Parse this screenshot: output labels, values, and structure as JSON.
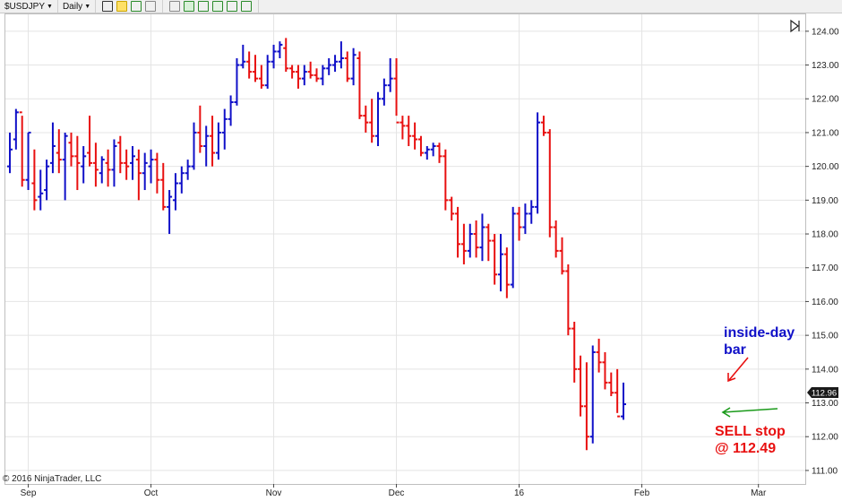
{
  "toolbar": {
    "symbol": "$USDJPY",
    "interval": "Daily",
    "tools": [
      "bar-style-icon",
      "pencil-icon",
      "drawing-tool-icon",
      "crosshair-icon",
      "zoom-icon",
      "data-box-icon",
      "grid-icon",
      "image-icon",
      "properties-icon",
      "export-icon"
    ]
  },
  "chart_data": {
    "type": "ohlc-bar",
    "x_ticks": [
      "Sep",
      "Oct",
      "Nov",
      "Dec",
      "16",
      "Feb",
      "Mar"
    ],
    "y_ticks": [
      111,
      112,
      113,
      114,
      115,
      116,
      117,
      118,
      119,
      120,
      121,
      122,
      123,
      124
    ],
    "y_tick_labels": [
      "111.00",
      "112.00",
      "113.00",
      "114.00",
      "115.00",
      "116.00",
      "117.00",
      "118.00",
      "119.00",
      "120.00",
      "121.00",
      "122.00",
      "123.00",
      "124.00"
    ],
    "ylim": [
      110.6,
      124.5
    ],
    "last_price": "112.96",
    "copyright": "© 2016 NinjaTrader, LLC",
    "colors": {
      "up": "#1010c8",
      "down": "#e81010"
    },
    "annotations": {
      "inside_day_line1": "inside-day",
      "inside_day_line2": "bar",
      "sell_line1": "SELL stop",
      "sell_line2": "@ 112.49"
    },
    "bars": [
      [
        120.0,
        121.0,
        119.8,
        120.5
      ],
      [
        120.8,
        121.7,
        120.5,
        121.6
      ],
      [
        121.6,
        121.5,
        119.4,
        119.6
      ],
      [
        119.6,
        121.0,
        119.3,
        121.0
      ],
      [
        119.5,
        120.5,
        118.7,
        119.0
      ],
      [
        119.1,
        119.9,
        118.7,
        119.2
      ],
      [
        119.3,
        120.2,
        119.0,
        120.0
      ],
      [
        120.1,
        121.3,
        119.8,
        120.6
      ],
      [
        120.4,
        121.1,
        119.8,
        120.2
      ],
      [
        120.2,
        121.0,
        119.0,
        120.9
      ],
      [
        120.7,
        121.0,
        120.0,
        120.3
      ],
      [
        120.3,
        120.9,
        119.3,
        120.1
      ],
      [
        120.0,
        120.6,
        119.5,
        120.3
      ],
      [
        120.4,
        121.5,
        120.0,
        120.1
      ],
      [
        120.1,
        120.7,
        119.4,
        119.9
      ],
      [
        119.8,
        120.3,
        119.5,
        120.2
      ],
      [
        120.1,
        120.5,
        119.4,
        119.9
      ],
      [
        119.9,
        120.8,
        119.4,
        120.6
      ],
      [
        120.7,
        120.9,
        119.8,
        120.1
      ],
      [
        120.1,
        120.5,
        119.6,
        120.0
      ],
      [
        120.1,
        120.6,
        119.6,
        120.3
      ],
      [
        120.2,
        120.5,
        119.0,
        119.8
      ],
      [
        119.8,
        120.4,
        119.3,
        120.1
      ],
      [
        120.0,
        120.5,
        119.5,
        120.2
      ],
      [
        120.2,
        120.4,
        119.2,
        119.6
      ],
      [
        119.6,
        120.1,
        118.7,
        118.8
      ],
      [
        118.8,
        119.3,
        118.0,
        119.1
      ],
      [
        119.0,
        119.8,
        118.7,
        119.5
      ],
      [
        119.5,
        120.0,
        119.2,
        119.8
      ],
      [
        119.8,
        120.2,
        119.6,
        120.0
      ],
      [
        120.0,
        121.3,
        119.9,
        121.0
      ],
      [
        121.0,
        121.8,
        120.4,
        120.6
      ],
      [
        120.6,
        121.2,
        120.0,
        120.9
      ],
      [
        120.9,
        121.5,
        120.0,
        120.4
      ],
      [
        120.4,
        121.3,
        120.2,
        121.0
      ],
      [
        121.0,
        121.7,
        120.5,
        121.4
      ],
      [
        121.4,
        122.1,
        121.2,
        121.9
      ],
      [
        121.9,
        123.2,
        121.8,
        123.0
      ],
      [
        123.0,
        123.6,
        122.9,
        123.1
      ],
      [
        123.1,
        123.4,
        122.6,
        122.8
      ],
      [
        122.8,
        123.3,
        122.5,
        122.6
      ],
      [
        122.6,
        123.0,
        122.3,
        122.4
      ],
      [
        122.4,
        123.3,
        122.3,
        123.1
      ],
      [
        123.1,
        123.6,
        122.9,
        123.4
      ],
      [
        123.4,
        123.7,
        123.2,
        123.6
      ],
      [
        123.5,
        123.8,
        122.8,
        122.9
      ],
      [
        122.9,
        123.0,
        122.6,
        122.8
      ],
      [
        122.8,
        123.0,
        122.3,
        122.6
      ],
      [
        122.6,
        123.0,
        122.4,
        122.8
      ],
      [
        122.8,
        123.1,
        122.6,
        122.7
      ],
      [
        122.7,
        122.9,
        122.5,
        122.6
      ],
      [
        122.6,
        123.0,
        122.4,
        122.9
      ],
      [
        122.9,
        123.2,
        122.7,
        123.0
      ],
      [
        123.0,
        123.3,
        122.8,
        123.1
      ],
      [
        123.1,
        123.7,
        122.9,
        123.2
      ],
      [
        123.2,
        123.4,
        122.5,
        122.6
      ],
      [
        122.6,
        123.5,
        122.4,
        123.3
      ],
      [
        123.2,
        123.4,
        121.4,
        121.5
      ],
      [
        121.5,
        121.8,
        121.0,
        121.3
      ],
      [
        121.3,
        122.0,
        120.7,
        120.9
      ],
      [
        120.9,
        122.2,
        120.6,
        122.0
      ],
      [
        122.0,
        122.6,
        121.8,
        122.4
      ],
      [
        122.4,
        123.2,
        122.2,
        122.6
      ],
      [
        122.6,
        123.2,
        121.5,
        121.3
      ],
      [
        121.3,
        121.5,
        120.8,
        121.2
      ],
      [
        121.2,
        121.5,
        120.6,
        120.9
      ],
      [
        120.9,
        121.3,
        120.5,
        120.8
      ],
      [
        120.8,
        120.9,
        120.3,
        120.4
      ],
      [
        120.4,
        120.6,
        120.2,
        120.5
      ],
      [
        120.5,
        120.7,
        120.3,
        120.6
      ],
      [
        120.6,
        120.7,
        120.1,
        120.3
      ],
      [
        120.3,
        120.5,
        118.7,
        119.0
      ],
      [
        119.0,
        119.1,
        118.4,
        118.6
      ],
      [
        118.6,
        118.8,
        117.3,
        117.7
      ],
      [
        117.7,
        118.3,
        117.1,
        117.5
      ],
      [
        117.5,
        118.3,
        117.3,
        118.0
      ],
      [
        118.0,
        118.4,
        117.3,
        117.6
      ],
      [
        117.6,
        118.6,
        117.2,
        118.2
      ],
      [
        118.2,
        118.3,
        117.2,
        117.8
      ],
      [
        117.8,
        118.0,
        116.5,
        116.8
      ],
      [
        116.8,
        118.0,
        116.3,
        117.4
      ],
      [
        117.4,
        117.6,
        116.1,
        116.5
      ],
      [
        116.5,
        118.8,
        116.4,
        118.6
      ],
      [
        118.6,
        118.8,
        117.8,
        118.2
      ],
      [
        118.2,
        118.9,
        118.0,
        118.6
      ],
      [
        118.6,
        119.0,
        118.3,
        118.8
      ],
      [
        118.8,
        121.6,
        118.6,
        121.3
      ],
      [
        121.3,
        121.5,
        120.9,
        121.0
      ],
      [
        121.0,
        121.1,
        117.9,
        118.2
      ],
      [
        118.2,
        118.4,
        117.3,
        117.5
      ],
      [
        117.5,
        117.9,
        116.8,
        116.9
      ],
      [
        116.9,
        117.1,
        115.0,
        115.2
      ],
      [
        115.2,
        115.4,
        113.6,
        114.0
      ],
      [
        114.0,
        114.4,
        112.6,
        112.9
      ],
      [
        112.9,
        114.2,
        111.6,
        112.0
      ],
      [
        112.0,
        114.7,
        111.8,
        114.5
      ],
      [
        114.5,
        114.9,
        113.9,
        114.2
      ],
      [
        114.2,
        114.5,
        113.4,
        113.6
      ],
      [
        113.6,
        113.9,
        113.2,
        113.3
      ],
      [
        113.3,
        114.0,
        112.7,
        112.6
      ],
      [
        112.6,
        113.6,
        112.5,
        112.96
      ]
    ]
  }
}
